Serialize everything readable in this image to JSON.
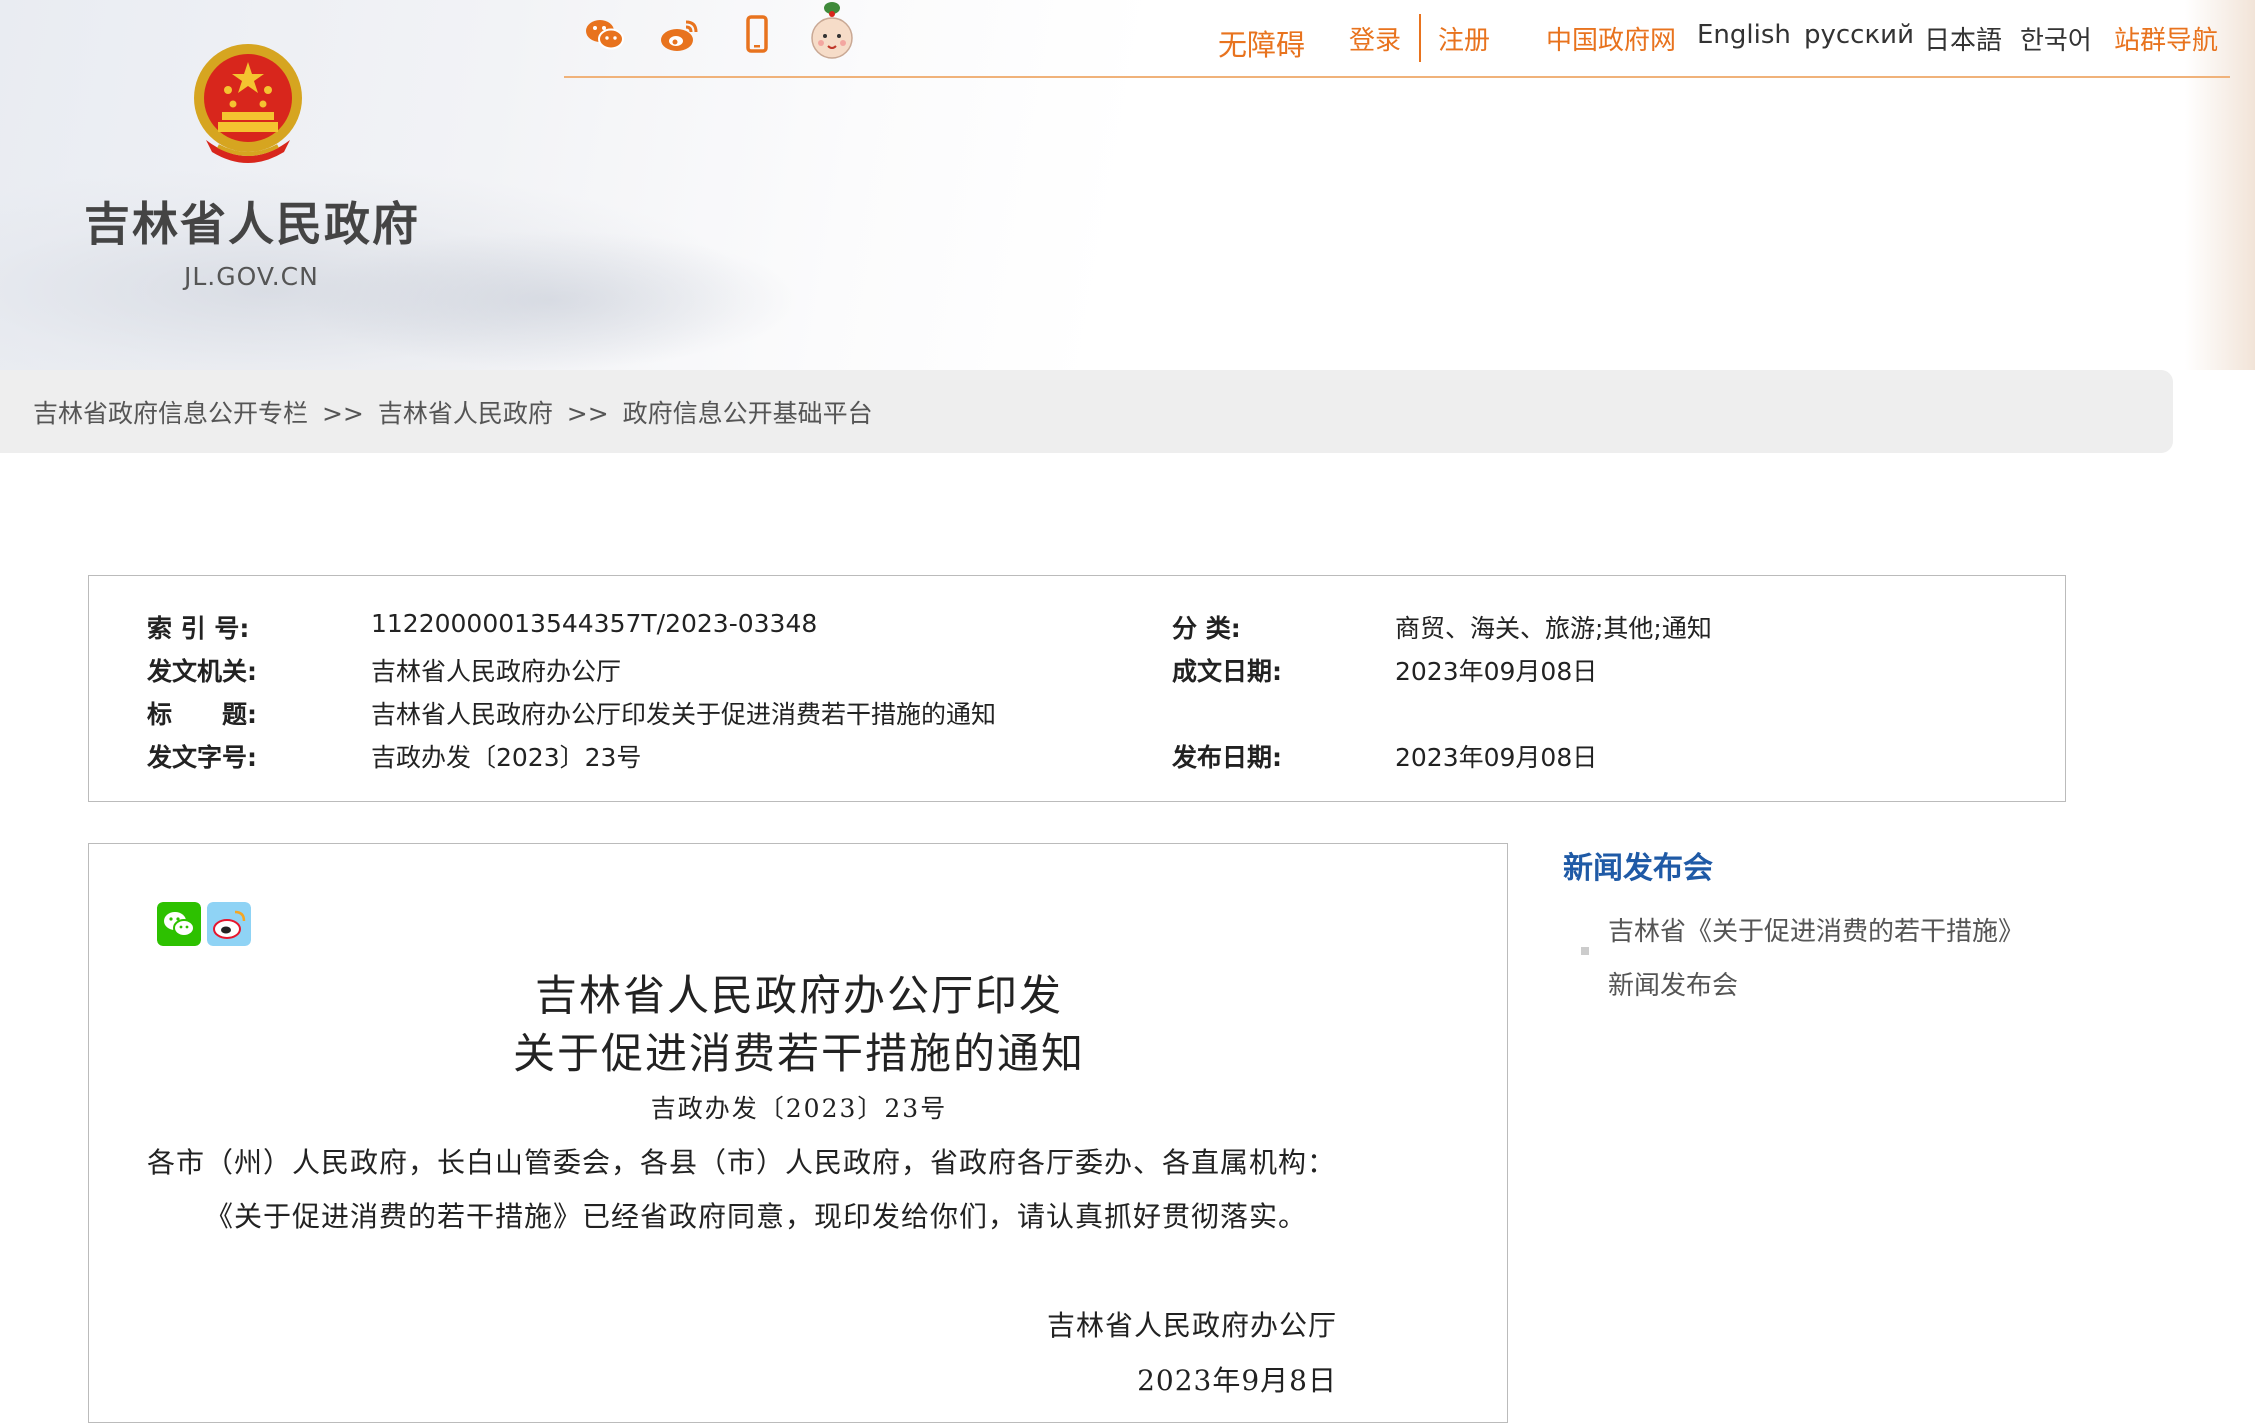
{
  "header": {
    "site_title": "吉林省人民政府",
    "site_domain": "JL.GOV.CN",
    "social_icons": [
      "wechat-icon",
      "weibo-icon",
      "mobile-icon",
      "mascot-icon"
    ],
    "links": {
      "accessibility": "无障碍",
      "login": "登录",
      "register": "注册",
      "china_gov": "中国政府网",
      "english": "English",
      "russian": "русский",
      "japanese": "日本語",
      "korean": "한국어",
      "site_nav": "站群导航"
    },
    "accent_color": "#e8731e"
  },
  "breadcrumb": {
    "items": [
      "吉林省政府信息公开专栏",
      "吉林省人民政府",
      "政府信息公开基础平台"
    ],
    "separator": ">>"
  },
  "info": {
    "index_label": "索 引 号:",
    "index_value": "11220000013544357T/2023-03348",
    "category_label": "分 类:",
    "category_value": "商贸、海关、旅游;其他;通知",
    "issuer_label": "发文机关:",
    "issuer_value": "吉林省人民政府办公厅",
    "created_label": "成文日期:",
    "created_value": "2023年09月08日",
    "title_label": "标　　题:",
    "title_value": "吉林省人民政府办公厅印发关于促进消费若干措施的通知",
    "docno_label": "发文字号:",
    "docno_value": "吉政办发〔2023〕23号",
    "published_label": "发布日期:",
    "published_value": "2023年09月08日"
  },
  "article": {
    "title_line1": "吉林省人民政府办公厅印发",
    "title_line2": "关于促进消费若干措施的通知",
    "doc_number": "吉政办发〔2023〕23号",
    "addressee": "各市（州）人民政府，长白山管委会，各县（市）人民政府，省政府各厅委办、各直属机构：",
    "body": "《关于促进消费的若干措施》已经省政府同意，现印发给你们，请认真抓好贯彻落实。",
    "signer": "吉林省人民政府办公厅",
    "date": "2023年9月8日"
  },
  "sidebar": {
    "title": "新闻发布会",
    "items": [
      "吉林省《关于促进消费的若干措施》新闻发布会"
    ]
  }
}
